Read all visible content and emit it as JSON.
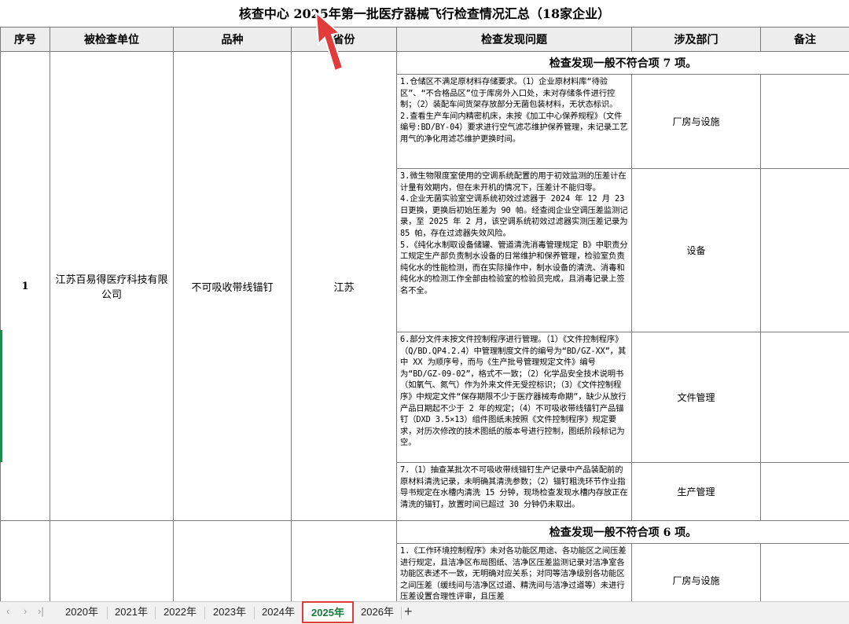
{
  "title": "核查中心 2025年第一批医疗器械飞行检查情况汇总（18家企业）",
  "headers": [
    "序号",
    "被检查单位",
    "品种",
    "省份",
    "检查发现问题",
    "涉及部门",
    "备注"
  ],
  "record1": {
    "seq": "1",
    "company": "江苏百易得医疗科技有限公司",
    "product": "不可吸收带线锚钉",
    "province": "江苏",
    "summary": "检查发现一般不符合项  7 项。",
    "issues": [
      {
        "text": "1.仓储区不满足原材料存储要求。（1）企业原材料库“待验区”、“不合格品区”位于库房外入口处，未对存储条件进行控制；（2）装配车间货架存放部分无菌包装材料，无状态标识。\n2.查看生产车间内精密机床，未按《加工中心保养规程》（文件编号:BD/BY-04）要求进行空气滤芯维护保养管理，未记录工艺用气的净化用滤芯维护更换时间。",
        "dept": "厂房与设施"
      },
      {
        "text": "3.微生物限度室使用的空调系统配置的用于初效监测的压差计在计量有效期内，但在未开机的情况下，压差计不能归零。\n4.企业无菌实验室空调系统初效过滤器于 2024 年 12 月 23 日更换，更换后初始压差为 90 帕。经查阅企业空调压差监测记录，至 2025 年 2 月，该空调系统初效过滤器实测压差记录为 85 帕，存在过滤器失效风险。\n5.《纯化水制取设备储罐、管道清洗消毒管理规定 B》中职责分工规定生产部负责制水设备的日常维护和保养管理，检验室负责纯化水的性能检测，而在实际操作中，制水设备的清洗、消毒和纯化水的检测工作全部由检验室的检验员完成，且消毒记录上签名不全。",
        "dept": "设备"
      },
      {
        "text": "6.部分文件未按文件控制程序进行管理。（1）《文件控制程序》（Q/BD.QP4.2.4）中管理制度文件的编号为“BD/GZ-XX”，其中 XX 为顺序号，而与《生产批号管理规定文件》编号为“BD/GZ-09-02”，格式不一致；（2）化学品安全技术说明书（如氧气、氮气）作为外来文件无受控标识；（3）《文件控制程序》中规定文件“保存期限不少于医疗器械寿命期”，缺少从放行产品日期起不少于 2 年的规定；（4）不可吸收带线锚钉产品锚钉（DXD 3.5×13）组件图纸未按照《文件控制程序》规定要求，对历次修改的技术图纸的版本号进行控制，图纸阶段标记为空。",
        "dept": "文件管理"
      },
      {
        "text": "7.（1）抽查某批次不可吸收带线锚钉生产记录中产品装配前的原材料清洗记录，未明确其清洗参数；（2）锚钉粗洗环节作业指导书规定在水槽内清洗 15 分钟，现场检查发现水槽内存放正在清洗的锚钉，放置时间已超过 30 分钟仍未取出。",
        "dept": "生产管理"
      }
    ]
  },
  "record2": {
    "summary": "检查发现一般不符合项  6 项。",
    "issues": [
      {
        "text": "1.《工作环境控制程序》未对各功能区用途、各功能区之间压差进行规定，且洁净区布局图纸、洁净区压差监测记录对洁净室各功能区表述不一致，无明确对应关系；对同等洁净级别各功能区之间压差（缓线间与洁净区过道、精洗间与洁净过道等）未进行压差设置合理性评审，且压差",
        "dept": "厂房与设施"
      }
    ]
  },
  "tabs": [
    "2020年",
    "2021年",
    "2022年",
    "2023年",
    "2024年",
    "2025年",
    "2026年"
  ],
  "active_tab": "2025年",
  "tab_nav": {
    "prev": "‹",
    "next": "›",
    "last": "›|",
    "add": "+"
  },
  "colors": {
    "accent_red": "#e23b3b",
    "active_tab_text": "#1a7a3a",
    "header_bg": "#ededed"
  }
}
